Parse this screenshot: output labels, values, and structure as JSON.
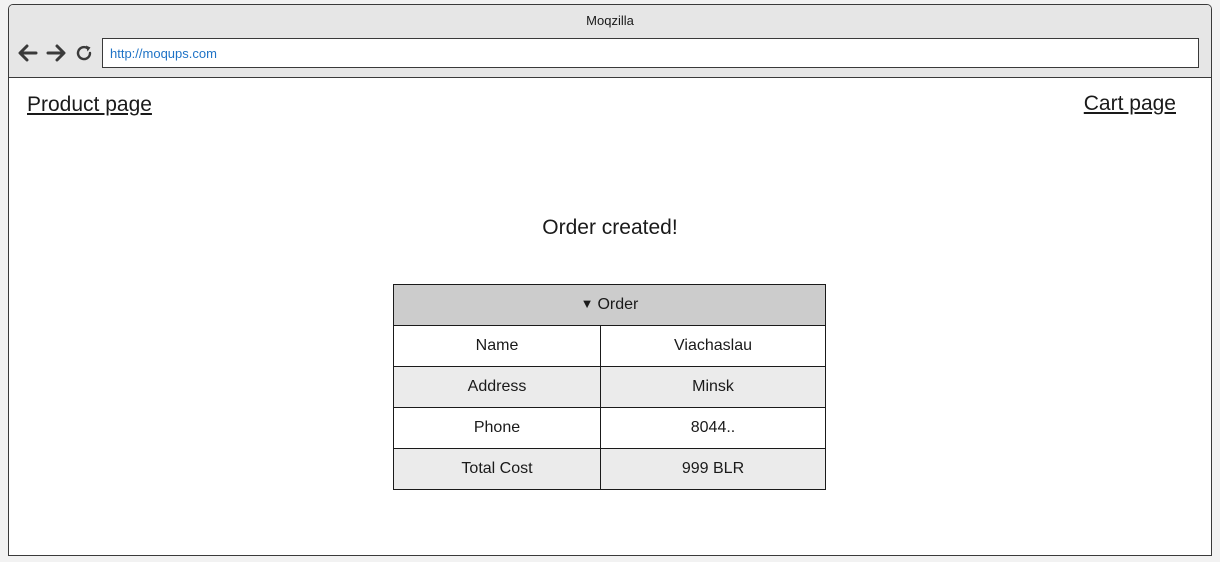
{
  "window": {
    "title": "Moqzilla"
  },
  "toolbar": {
    "back_icon": "arrow-left-icon",
    "forward_icon": "arrow-right-icon",
    "reload_icon": "reload-icon",
    "url": "http://moqups.com"
  },
  "nav": {
    "product_link": "Product page",
    "cart_link": "Cart page"
  },
  "main": {
    "headline": "Order created!"
  },
  "order": {
    "header": "Order",
    "caret_icon": "triangle-down-icon",
    "rows": [
      {
        "label": "Name",
        "value": "Viachaslau"
      },
      {
        "label": "Address",
        "value": "Minsk"
      },
      {
        "label": "Phone",
        "value": "8044.."
      },
      {
        "label": "Total Cost",
        "value": "999 BLR"
      }
    ]
  },
  "colors": {
    "frame": "#e6e6e6",
    "url_text": "#1f73c6",
    "table_header": "#cccccc",
    "table_alt_row": "#ebebeb"
  }
}
